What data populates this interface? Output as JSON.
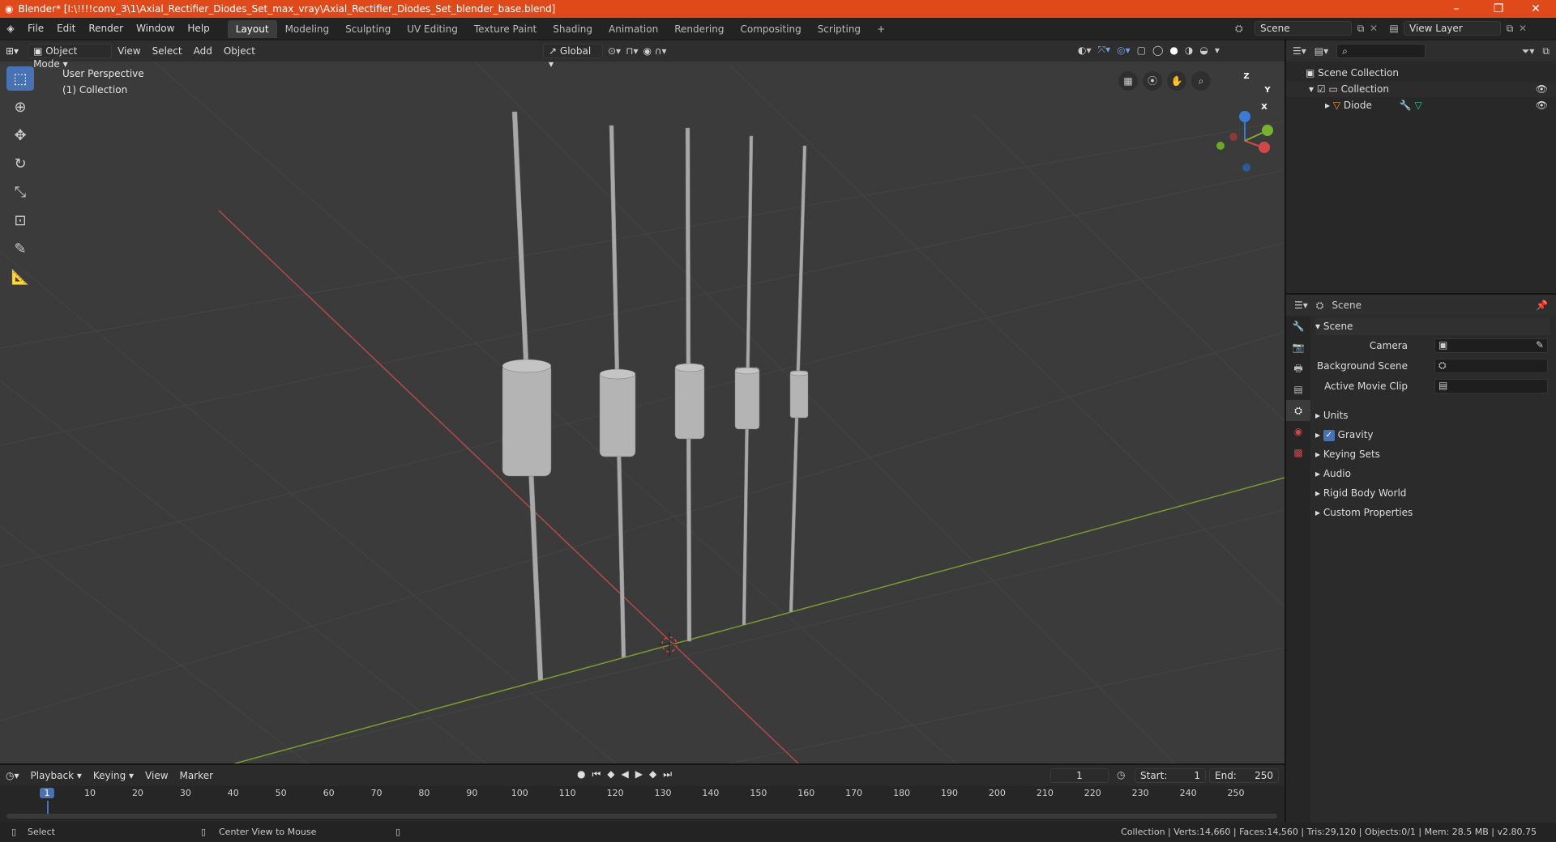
{
  "window": {
    "title": "Blender* [I:\\!!!!conv_3\\1\\Axial_Rectifier_Diodes_Set_max_vray\\Axial_Rectifier_Diodes_Set_blender_base.blend]",
    "minimize": "–",
    "restore": "❐",
    "close": "✕"
  },
  "menu": [
    "File",
    "Edit",
    "Render",
    "Window",
    "Help"
  ],
  "workspaces": [
    "Layout",
    "Modeling",
    "Sculpting",
    "UV Editing",
    "Texture Paint",
    "Shading",
    "Animation",
    "Rendering",
    "Compositing",
    "Scripting"
  ],
  "workspace_add": "+",
  "scene_field": "Scene",
  "view_layer_field": "View Layer",
  "viewport_header": {
    "mode": "Object Mode",
    "menus": [
      "View",
      "Select",
      "Add",
      "Object"
    ],
    "orientation": "Global"
  },
  "viewport": {
    "perspective": "User Perspective",
    "collection": "(1) Collection",
    "gizmo_axes": {
      "x": "X",
      "y": "Y",
      "z": "Z"
    }
  },
  "outliner": {
    "search_placeholder": "",
    "scene_collection": "Scene Collection",
    "collection": "Collection",
    "object": "Diode"
  },
  "properties": {
    "tab_title": "Scene",
    "section": "Scene",
    "camera_label": "Camera",
    "background_scene_label": "Background Scene",
    "active_movie_clip_label": "Active Movie Clip",
    "panels": [
      "Units",
      "Gravity",
      "Keying Sets",
      "Audio",
      "Rigid Body World",
      "Custom Properties"
    ],
    "gravity_checked": true
  },
  "timeline": {
    "menus": [
      "Playback",
      "Keying",
      "View",
      "Marker"
    ],
    "current_frame": "1",
    "start_label": "Start:",
    "start": "1",
    "end_label": "End:",
    "end": "250",
    "ticks": [
      "1",
      "10",
      "20",
      "30",
      "40",
      "50",
      "60",
      "70",
      "80",
      "90",
      "100",
      "110",
      "120",
      "130",
      "140",
      "150",
      "160",
      "170",
      "180",
      "190",
      "200",
      "210",
      "220",
      "230",
      "240",
      "250"
    ]
  },
  "status": {
    "left_action": "Select",
    "mid_action": "Center View to Mouse",
    "stats": "Collection | Verts:14,660 | Faces:14,560 | Tris:29,120 | Objects:0/1 | Mem: 28.5 MB | v2.80.75"
  },
  "colors": {
    "title_bar": "#e0491a",
    "accent": "#4772b3",
    "viewport_bg": "#3b3b3b",
    "x_axis": "#b34a4a",
    "y_axis": "#7a9a30"
  }
}
